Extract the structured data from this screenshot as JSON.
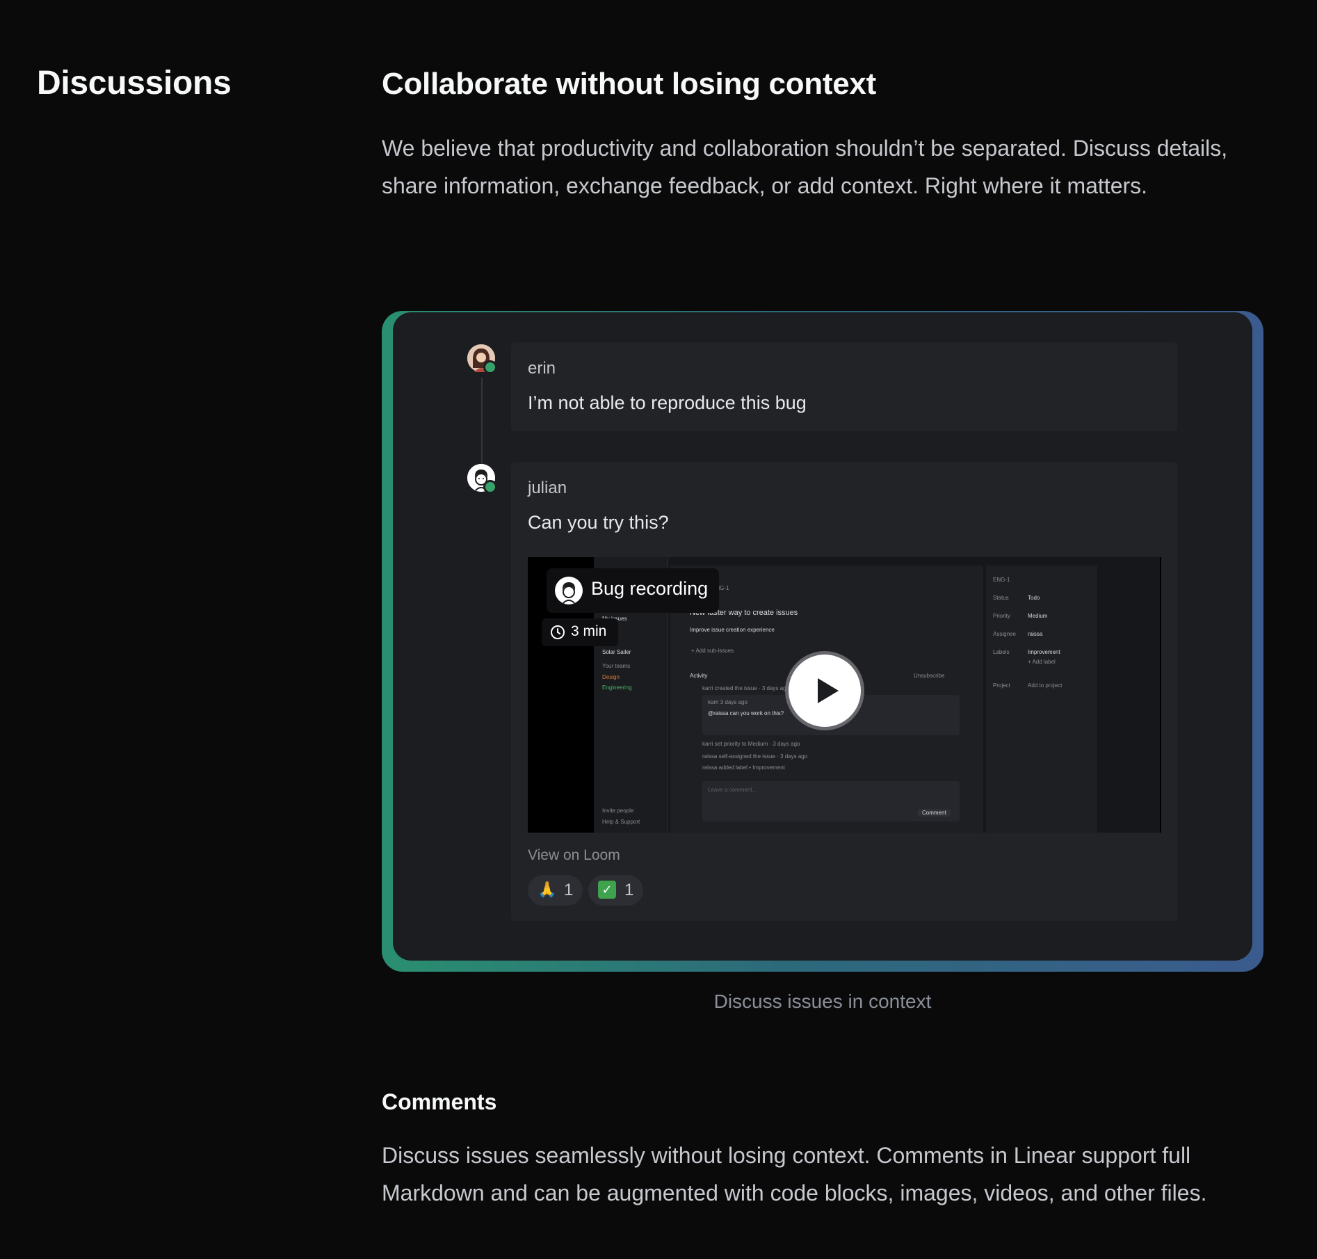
{
  "section": {
    "label": "Discussions"
  },
  "feature": {
    "title": "Collaborate without losing context",
    "description": "We believe that productivity and collaboration shouldn’t be separated. Discuss details, share information, exchange feedback, or add context. Right where it matters."
  },
  "thread": {
    "comments": [
      {
        "author": "erin",
        "text": "I’m not able to reproduce this bug",
        "avatar_icon": "user-avatar-icon",
        "status": "online"
      },
      {
        "author": "julian",
        "text": "Can you try this?",
        "avatar_icon": "user-avatar-icon",
        "status": "online",
        "attachment": {
          "type": "video",
          "title": "Bug recording",
          "duration": "3 min",
          "link_label": "View on Loom",
          "play_icon": "play-icon",
          "clock_icon": "clock-icon",
          "preview": {
            "sidebar": [
              "My issues",
              "Solar Sailer",
              "Your teams",
              "Design",
              "Engineering",
              "Invite people",
              "Help & Support"
            ],
            "issue_id": "ENG-1",
            "issue_title": "New faster way to create issues",
            "issue_subtitle": "Improve issue creation experience",
            "add_sub_issues": "+ Add sub-issues",
            "activity_label": "Activity",
            "unsubscribe": "Unsubscribe",
            "activity": [
              "karri created the issue · 3 days ago",
              "karri 3 days ago",
              "@raissa can you work on this?",
              "karri set priority to Medium · 3 days ago",
              "raissa self-assigned the issue · 3 days ago",
              "raissa added label • Improvement"
            ],
            "comment_placeholder": "Leave a comment...",
            "comment_button": "Comment",
            "props": [
              {
                "label": "Status",
                "value": "Todo"
              },
              {
                "label": "Priority",
                "value": "Medium"
              },
              {
                "label": "Assignee",
                "value": "raissa"
              },
              {
                "label": "Labels",
                "value": "Improvement"
              },
              {
                "label": "Project",
                "value": "Add to project"
              }
            ],
            "add_label": "+ Add label"
          }
        },
        "reactions": [
          {
            "emoji": "🙏",
            "icon": "folded-hands-icon",
            "count": "1"
          },
          {
            "emoji": "✅",
            "icon": "check-mark-icon",
            "count": "1"
          }
        ]
      }
    ],
    "caption": "Discuss issues in context"
  },
  "comments_section": {
    "title": "Comments",
    "description": "Discuss issues seamlessly without losing context. Comments in Linear support full Markdown and can be augmented with code blocks, images, videos, and other files."
  },
  "colors": {
    "background": "#0a0a0b",
    "panel": "#1c1d21",
    "card": "#222327",
    "online": "#38a169",
    "frame_gradient_start": "#2a8f70",
    "frame_gradient_end": "#3b5b8e"
  }
}
